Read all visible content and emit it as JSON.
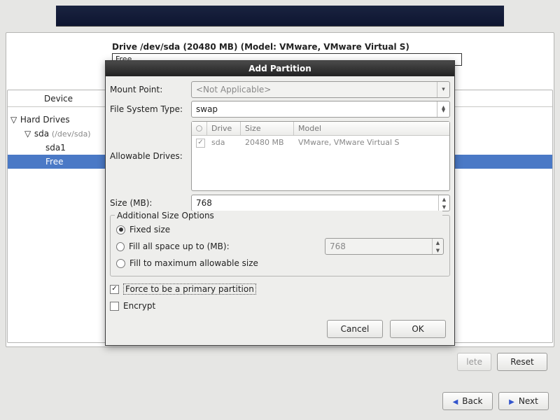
{
  "banner": {},
  "drive_header": "Drive /dev/sda (20480 MB) (Model: VMware, VMware Virtual S)",
  "diagram_label": "Free",
  "tree": {
    "header_device": "Device",
    "rows": [
      {
        "indent": 0,
        "expander": "▽",
        "label": "Hard Drives"
      },
      {
        "indent": 1,
        "expander": "▽",
        "label": "sda",
        "sub": "(/dev/sda)"
      },
      {
        "indent": 2,
        "expander": "",
        "label": "sda1"
      },
      {
        "indent": 2,
        "expander": "",
        "label": "Free",
        "selected": true
      }
    ]
  },
  "dialog": {
    "title": "Add Partition",
    "mount_point_label": "Mount Point:",
    "mount_point_value": "<Not Applicable>",
    "fs_type_label": "File System Type:",
    "fs_type_value": "swap",
    "allowable_drives_label": "Allowable Drives:",
    "drives_table": {
      "headers": {
        "checkbox": "",
        "drive": "Drive",
        "size": "Size",
        "model": "Model"
      },
      "rows": [
        {
          "checked": true,
          "drive": "sda",
          "size": "20480 MB",
          "model": "VMware, VMware Virtual S"
        }
      ]
    },
    "size_label": "Size (MB):",
    "size_value": "768",
    "size_options_legend": "Additional Size Options",
    "opt_fixed": "Fixed size",
    "opt_fill_upto": "Fill all space up to (MB):",
    "opt_fill_upto_value": "768",
    "opt_fill_max": "Fill to maximum allowable size",
    "selected_size_option": "fixed",
    "force_primary": "Force to be a primary partition",
    "force_primary_checked": true,
    "encrypt": "Encrypt",
    "encrypt_checked": false,
    "cancel": "Cancel",
    "ok": "OK"
  },
  "main_buttons": {
    "delete": "lete",
    "reset": "Reset"
  },
  "footer": {
    "back": "Back",
    "next": "Next"
  }
}
